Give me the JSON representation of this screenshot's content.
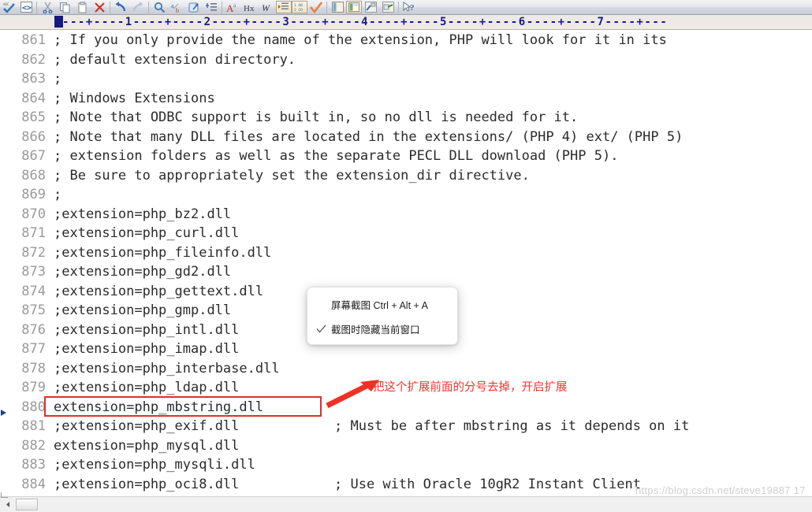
{
  "toolbar": {
    "groups": [
      {
        "items": [
          {
            "name": "spell-check-icon",
            "glyph": "spell"
          },
          {
            "name": "code-tags-icon",
            "glyph": "codetags"
          }
        ]
      },
      {
        "items": [
          {
            "name": "cut-icon",
            "glyph": "scissors"
          },
          {
            "name": "copy-icon",
            "glyph": "copy"
          },
          {
            "name": "paste-icon",
            "glyph": "paste"
          },
          {
            "name": "delete-icon",
            "glyph": "xred"
          }
        ]
      },
      {
        "items": [
          {
            "name": "undo-icon",
            "glyph": "undo"
          },
          {
            "name": "redo-icon",
            "glyph": "redo"
          }
        ]
      },
      {
        "items": [
          {
            "name": "find-icon",
            "glyph": "magnifier"
          },
          {
            "name": "replace-icon",
            "glyph": "replace"
          },
          {
            "name": "goto-icon",
            "glyph": "goto"
          },
          {
            "name": "insert-list-icon",
            "glyph": "addlist"
          }
        ]
      },
      {
        "items": [
          {
            "name": "font-format-icon",
            "glyph": "bigA"
          },
          {
            "name": "hex-view-icon",
            "glyph": "hx"
          },
          {
            "name": "word-wrap-icon",
            "glyph": "wital"
          },
          {
            "name": "indent-icon",
            "glyph": "indent",
            "framed": true
          },
          {
            "name": "line-numbers-icon",
            "glyph": "linenums",
            "framed": true
          },
          {
            "name": "syntax-check-icon",
            "glyph": "checkmark"
          }
        ]
      },
      {
        "items": [
          {
            "name": "panel-left-icon",
            "glyph": "panelleft"
          },
          {
            "name": "panel-table-icon",
            "glyph": "paneltable",
            "framed": true
          },
          {
            "name": "panel-blue-icon",
            "glyph": "panelblue"
          },
          {
            "name": "panel-green-icon",
            "glyph": "panelgreen"
          }
        ]
      },
      {
        "items": [
          {
            "name": "help-pointer-icon",
            "glyph": "helparrow"
          }
        ]
      }
    ]
  },
  "ruler": {
    "text": "----+----1----+----2----+----3----+----4----+----5----+----6----+----7----+---"
  },
  "editor": {
    "lines": [
      {
        "num": "861",
        "text": "; If you only provide the name of the extension, PHP will look for it in its"
      },
      {
        "num": "862",
        "text": "; default extension directory."
      },
      {
        "num": "863",
        "text": ";"
      },
      {
        "num": "864",
        "text": "; Windows Extensions"
      },
      {
        "num": "865",
        "text": "; Note that ODBC support is built in, so no dll is needed for it."
      },
      {
        "num": "866",
        "text": "; Note that many DLL files are located in the extensions/ (PHP 4) ext/ (PHP 5)"
      },
      {
        "num": "867",
        "text": "; extension folders as well as the separate PECL DLL download (PHP 5)."
      },
      {
        "num": "868",
        "text": "; Be sure to appropriately set the extension_dir directive."
      },
      {
        "num": "869",
        "text": ";"
      },
      {
        "num": "870",
        "text": ";extension=php_bz2.dll"
      },
      {
        "num": "871",
        "text": ";extension=php_curl.dll"
      },
      {
        "num": "872",
        "text": ";extension=php_fileinfo.dll"
      },
      {
        "num": "873",
        "text": ";extension=php_gd2.dll"
      },
      {
        "num": "874",
        "text": ";extension=php_gettext.dll"
      },
      {
        "num": "875",
        "text": ";extension=php_gmp.dll"
      },
      {
        "num": "876",
        "text": ";extension=php_intl.dll"
      },
      {
        "num": "877",
        "text": ";extension=php_imap.dll"
      },
      {
        "num": "878",
        "text": ";extension=php_interbase.dll"
      },
      {
        "num": "879",
        "text": ";extension=php_ldap.dll"
      },
      {
        "num": "880",
        "text": "extension=php_mbstring.dll",
        "bookmark": true,
        "boxed": true
      },
      {
        "num": "881",
        "text": ";extension=php_exif.dll",
        "comment": "; Must be after mbstring as it depends on it"
      },
      {
        "num": "882",
        "text": "extension=php_mysql.dll"
      },
      {
        "num": "883",
        "text": ";extension=php_mysqli.dll"
      },
      {
        "num": "884",
        "text": ";extension=php_oci8.dll",
        "comment": "; Use with Oracle 10gR2 Instant Client"
      }
    ]
  },
  "popup": {
    "items": [
      {
        "label": "屏幕截图 Ctrl + Alt + A",
        "checked": false
      },
      {
        "label": "截图时隐藏当前窗口",
        "checked": true
      }
    ]
  },
  "annotation": {
    "text": "把这个扩展前面的分号去掉，开启扩展",
    "color": "#f0362c"
  },
  "watermark": {
    "text": "https://blog.csdn.net/steve19887 17"
  },
  "colors": {
    "highlight_box": "#e32d2d",
    "ruler_text": "#1a1a8c",
    "line_number": "#9a9a9a",
    "code_text": "#2b2b2b",
    "bookmark": "#1c3f94"
  }
}
